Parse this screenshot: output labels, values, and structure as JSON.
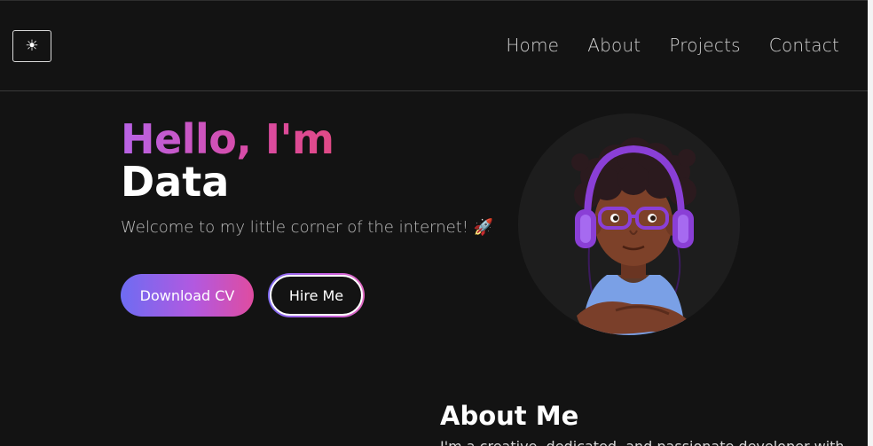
{
  "header": {
    "theme_toggle_icon": "sun-icon",
    "theme_toggle_glyph": "☀",
    "nav": [
      {
        "label": "Home"
      },
      {
        "label": "About"
      },
      {
        "label": "Projects"
      },
      {
        "label": "Contact"
      }
    ]
  },
  "hero": {
    "greeting": "Hello, I'm",
    "name": "Data",
    "subtitle": "Welcome to my little corner of the internet! 🚀",
    "download_label": "Download CV",
    "hire_label": "Hire Me"
  },
  "about": {
    "title": "About Me",
    "text": "I'm a creative, dedicated, and passionate developer with..."
  },
  "colors": {
    "background": "#131313",
    "gradient_start": "#6e6cf2",
    "gradient_mid": "#b259e0",
    "gradient_end": "#df4ca0",
    "avatar_headphones": "#8a3fd6",
    "avatar_shirt": "#7aa0e6"
  }
}
